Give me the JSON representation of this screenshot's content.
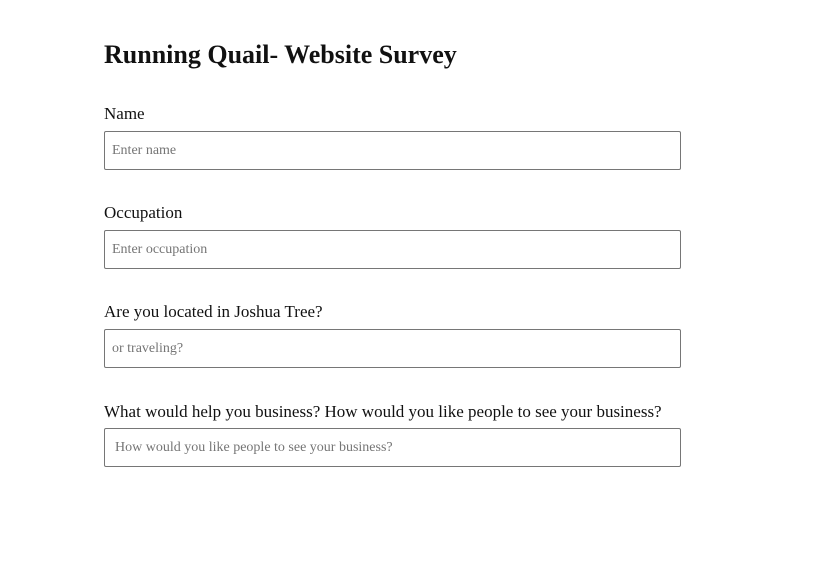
{
  "page": {
    "title": "Running Quail- Website Survey"
  },
  "fields": [
    {
      "label": "Name",
      "placeholder": "Enter name",
      "value": ""
    },
    {
      "label": "Occupation",
      "placeholder": "Enter occupation",
      "value": ""
    },
    {
      "label": "Are you located in Joshua Tree?",
      "placeholder": "or traveling?",
      "value": ""
    },
    {
      "label": "What would help you business? How would you like people to see your business?",
      "placeholder": "How would you like people to see your business?",
      "value": ""
    }
  ]
}
